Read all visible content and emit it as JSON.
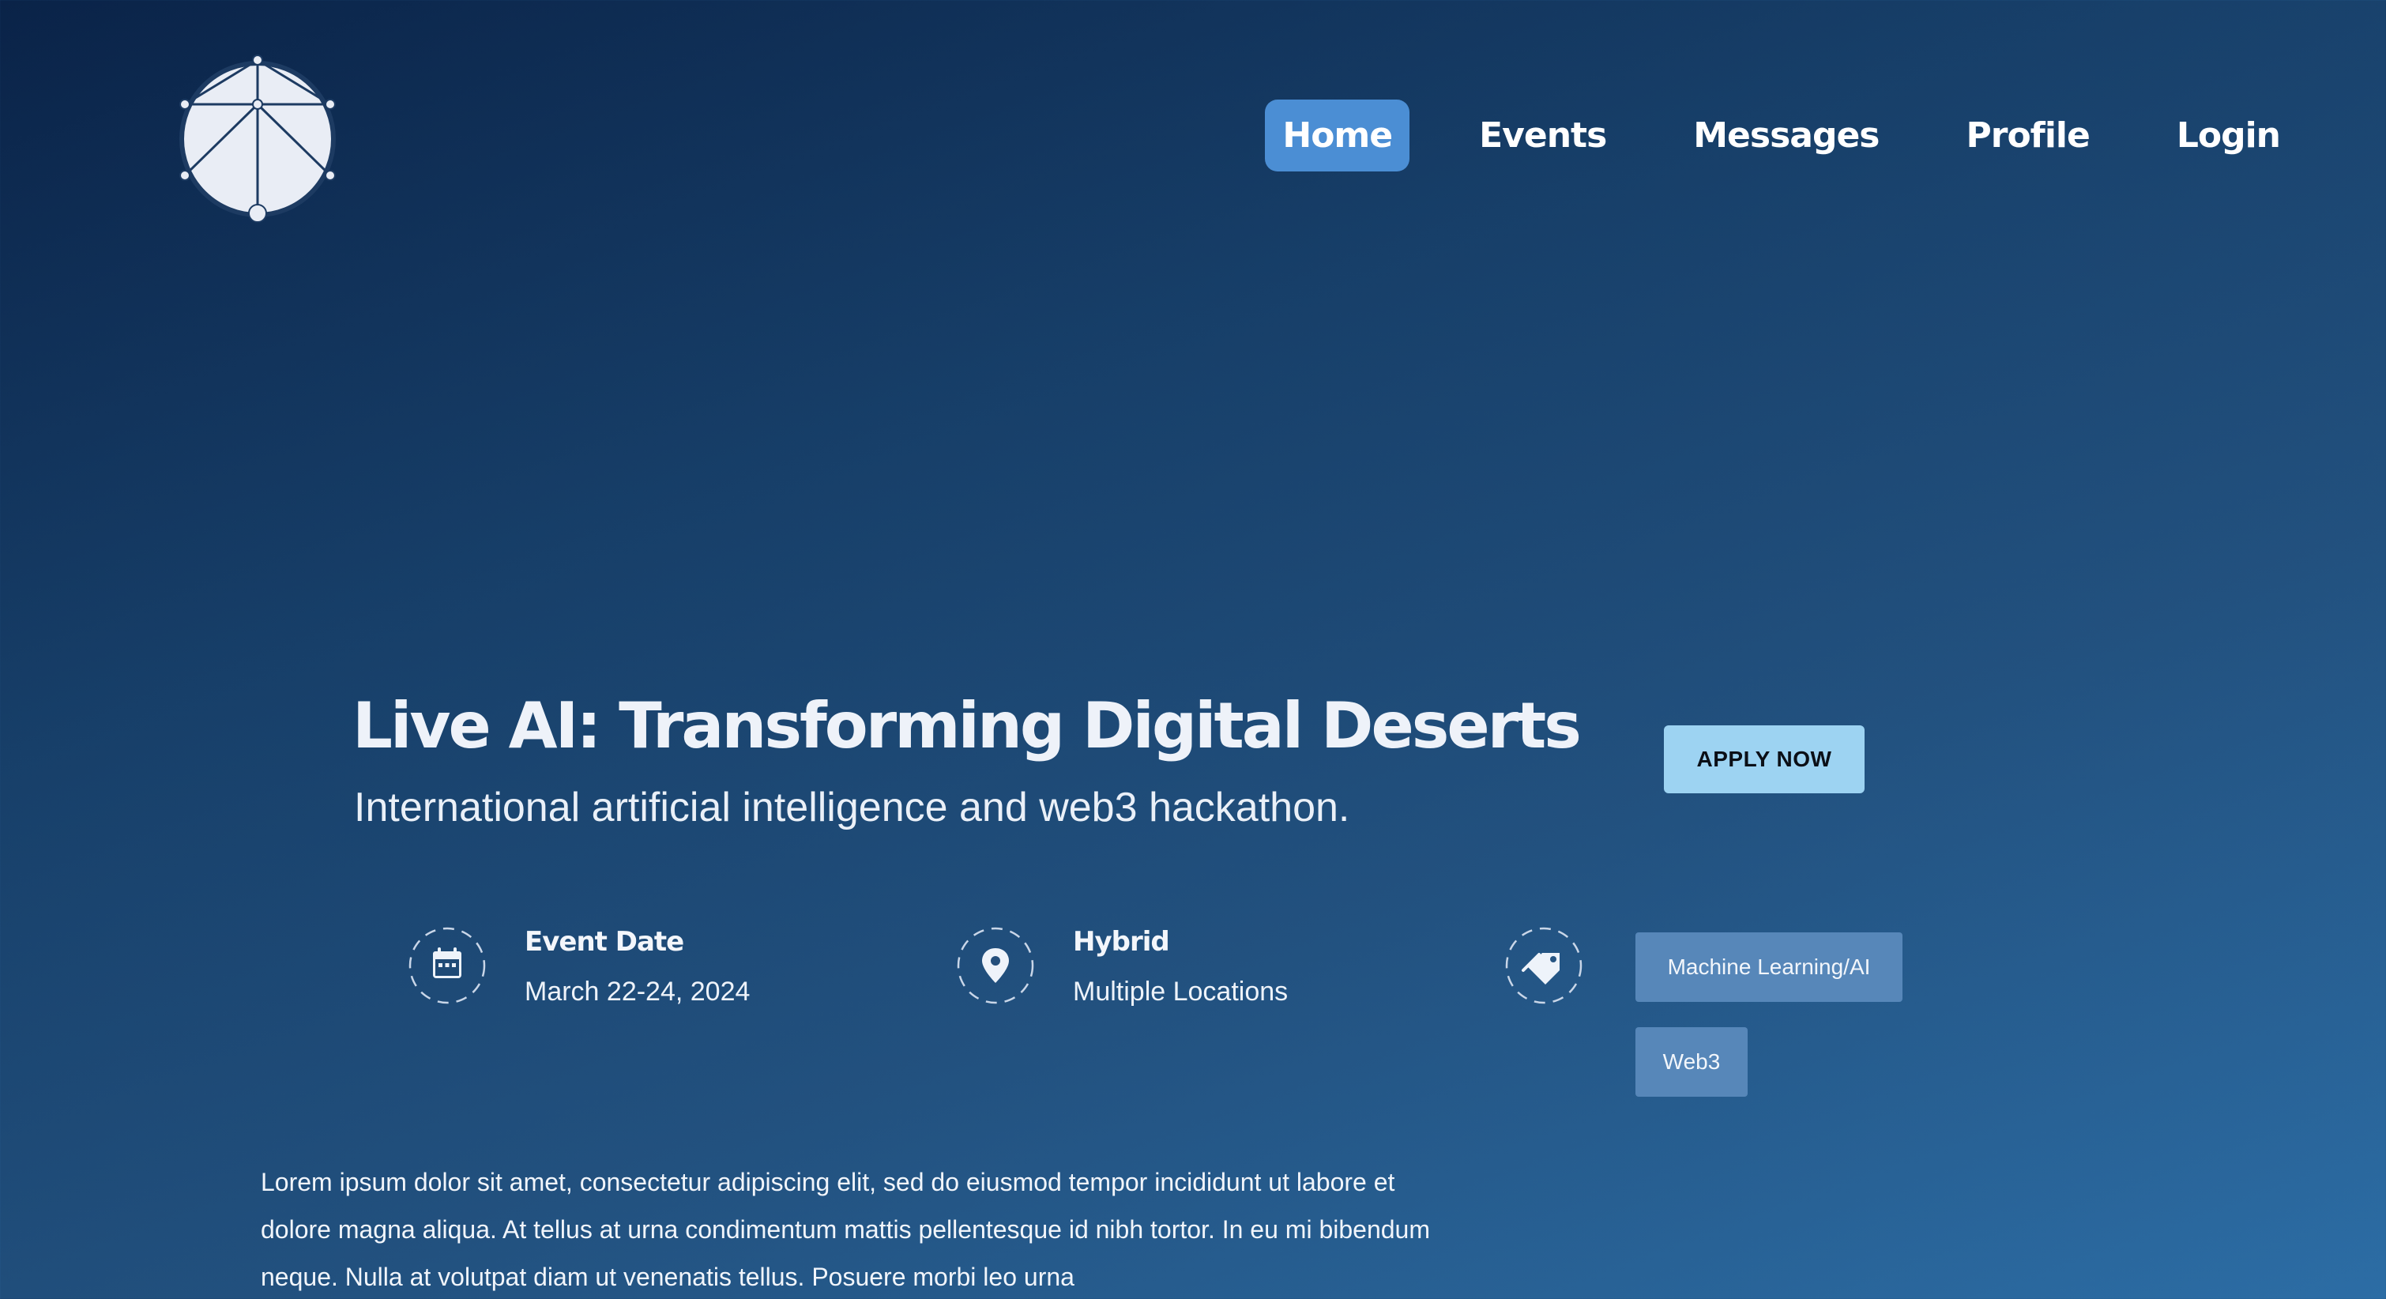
{
  "nav": {
    "items": [
      {
        "label": "Home",
        "active": true
      },
      {
        "label": "Events",
        "active": false
      },
      {
        "label": "Messages",
        "active": false
      },
      {
        "label": "Profile",
        "active": false
      },
      {
        "label": "Login",
        "active": false
      }
    ]
  },
  "hero": {
    "title": "Live AI: Transforming Digital Deserts",
    "subtitle": "International artificial intelligence and web3 hackathon.",
    "apply_label": "APPLY NOW"
  },
  "event_info": {
    "date_label": "Event Date",
    "date_value": "March 22-24, 2024",
    "location_label": "Hybrid",
    "location_value": "Multiple Locations",
    "tags": [
      "Machine Learning/AI",
      "Web3"
    ]
  },
  "description": "Lorem ipsum dolor sit amet, consectetur adipiscing elit, sed do eiusmod tempor incididunt ut labore et dolore magna aliqua. At tellus at urna condimentum mattis pellentesque id nibh tortor. In eu mi bibendum neque. Nulla at volutpat diam ut venenatis tellus. Posuere morbi leo urna",
  "colors": {
    "background_start": "#0a2348",
    "background_end": "#2c6da5",
    "nav_active": "#4b8ed4",
    "apply_button": "#9dd3f2",
    "tag": "#5787b9"
  },
  "icons": {
    "logo": "network-globe-logo",
    "date": "calendar-icon",
    "location": "map-pin-icon",
    "tags": "tag-icon"
  }
}
